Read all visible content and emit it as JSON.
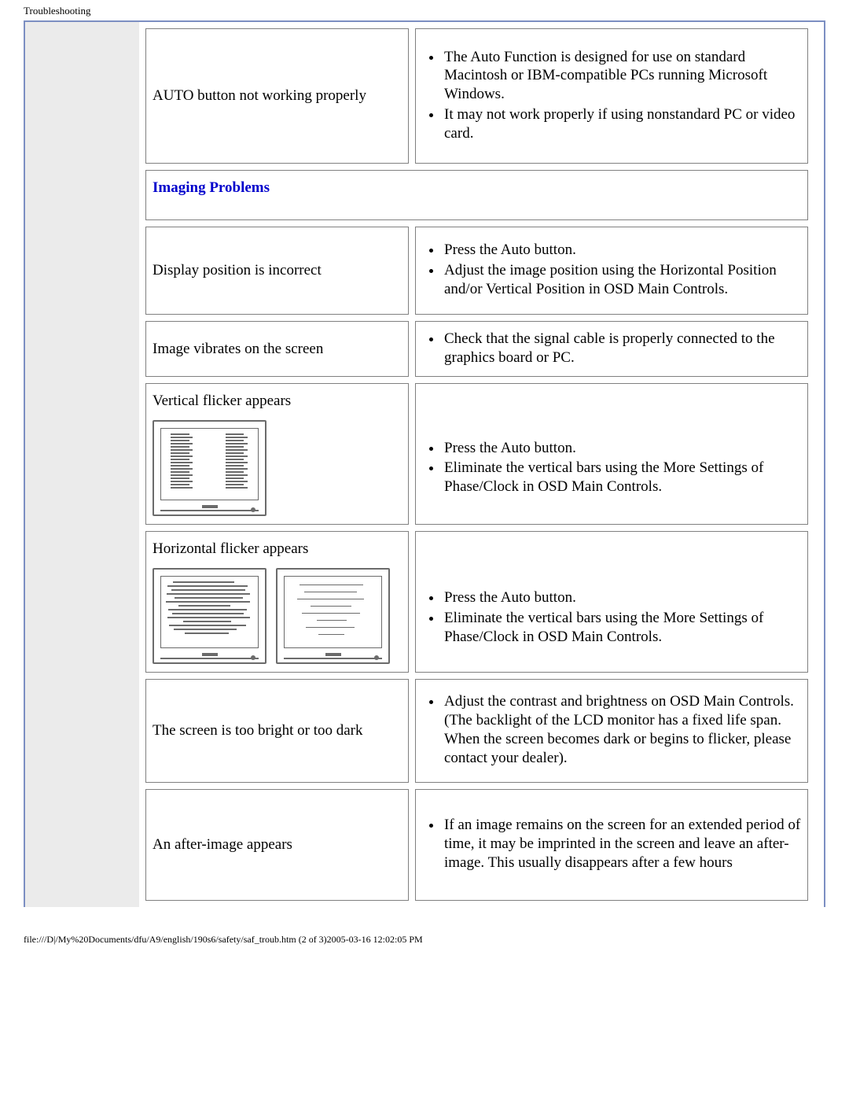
{
  "page_title": "Troubleshooting",
  "rows": {
    "r0_problem": "AUTO button not working properly",
    "r0_s0": "The Auto Function is designed for use on standard Macintosh or IBM-compatible PCs running Microsoft Windows.",
    "r0_s1": "It may not work properly if using nonstandard PC or video card.",
    "section": "Imaging Problems",
    "r1_problem": "Display position is incorrect",
    "r1_s0": "Press the Auto button.",
    "r1_s1": "Adjust the image position using the Horizontal Position and/or Vertical Position in OSD Main Controls.",
    "r2_problem": "Image vibrates on the screen",
    "r2_s0": "Check that the signal cable is properly connected to the graphics board or PC.",
    "r3_problem": "Vertical flicker appears",
    "r3_s0": "Press the Auto button.",
    "r3_s1": "Eliminate the vertical bars using the More Settings of Phase/Clock in OSD Main Controls.",
    "r4_problem": "Horizontal flicker appears",
    "r4_s0": "Press the Auto button.",
    "r4_s1": "Eliminate the vertical bars using the More Settings of Phase/Clock in OSD Main Controls.",
    "r5_problem": "The screen is too bright or too dark",
    "r5_s0": "Adjust the contrast and brightness on OSD Main Controls. (The backlight of the LCD monitor has a fixed life span. When the screen becomes dark or begins to flicker, please contact your dealer).",
    "r6_problem": "An after-image appears",
    "r6_s0": "If an image remains on the screen for an extended period of time, it may be imprinted in the screen and leave an after-image. This usually disappears after a few hours"
  },
  "footer": "file:///D|/My%20Documents/dfu/A9/english/190s6/safety/saf_troub.htm (2 of 3)2005-03-16 12:02:05 PM"
}
